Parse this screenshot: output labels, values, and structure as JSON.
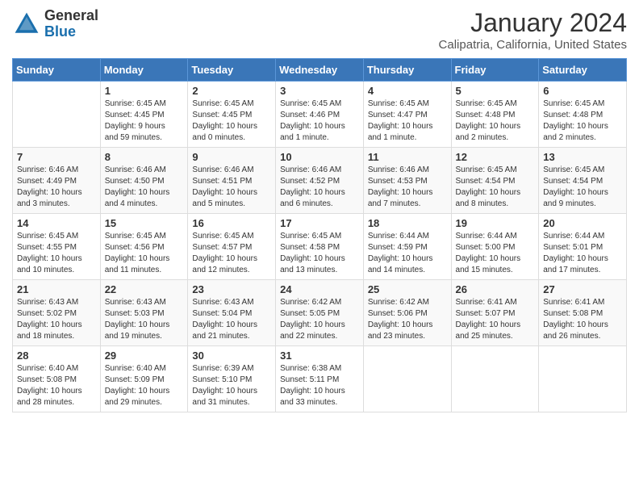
{
  "header": {
    "logo_general": "General",
    "logo_blue": "Blue",
    "month_year": "January 2024",
    "location": "Calipatria, California, United States"
  },
  "weekdays": [
    "Sunday",
    "Monday",
    "Tuesday",
    "Wednesday",
    "Thursday",
    "Friday",
    "Saturday"
  ],
  "weeks": [
    [
      {
        "day": "",
        "info": ""
      },
      {
        "day": "1",
        "info": "Sunrise: 6:45 AM\nSunset: 4:45 PM\nDaylight: 9 hours\nand 59 minutes."
      },
      {
        "day": "2",
        "info": "Sunrise: 6:45 AM\nSunset: 4:45 PM\nDaylight: 10 hours\nand 0 minutes."
      },
      {
        "day": "3",
        "info": "Sunrise: 6:45 AM\nSunset: 4:46 PM\nDaylight: 10 hours\nand 1 minute."
      },
      {
        "day": "4",
        "info": "Sunrise: 6:45 AM\nSunset: 4:47 PM\nDaylight: 10 hours\nand 1 minute."
      },
      {
        "day": "5",
        "info": "Sunrise: 6:45 AM\nSunset: 4:48 PM\nDaylight: 10 hours\nand 2 minutes."
      },
      {
        "day": "6",
        "info": "Sunrise: 6:45 AM\nSunset: 4:48 PM\nDaylight: 10 hours\nand 2 minutes."
      }
    ],
    [
      {
        "day": "7",
        "info": "Sunrise: 6:46 AM\nSunset: 4:49 PM\nDaylight: 10 hours\nand 3 minutes."
      },
      {
        "day": "8",
        "info": "Sunrise: 6:46 AM\nSunset: 4:50 PM\nDaylight: 10 hours\nand 4 minutes."
      },
      {
        "day": "9",
        "info": "Sunrise: 6:46 AM\nSunset: 4:51 PM\nDaylight: 10 hours\nand 5 minutes."
      },
      {
        "day": "10",
        "info": "Sunrise: 6:46 AM\nSunset: 4:52 PM\nDaylight: 10 hours\nand 6 minutes."
      },
      {
        "day": "11",
        "info": "Sunrise: 6:46 AM\nSunset: 4:53 PM\nDaylight: 10 hours\nand 7 minutes."
      },
      {
        "day": "12",
        "info": "Sunrise: 6:45 AM\nSunset: 4:54 PM\nDaylight: 10 hours\nand 8 minutes."
      },
      {
        "day": "13",
        "info": "Sunrise: 6:45 AM\nSunset: 4:54 PM\nDaylight: 10 hours\nand 9 minutes."
      }
    ],
    [
      {
        "day": "14",
        "info": "Sunrise: 6:45 AM\nSunset: 4:55 PM\nDaylight: 10 hours\nand 10 minutes."
      },
      {
        "day": "15",
        "info": "Sunrise: 6:45 AM\nSunset: 4:56 PM\nDaylight: 10 hours\nand 11 minutes."
      },
      {
        "day": "16",
        "info": "Sunrise: 6:45 AM\nSunset: 4:57 PM\nDaylight: 10 hours\nand 12 minutes."
      },
      {
        "day": "17",
        "info": "Sunrise: 6:45 AM\nSunset: 4:58 PM\nDaylight: 10 hours\nand 13 minutes."
      },
      {
        "day": "18",
        "info": "Sunrise: 6:44 AM\nSunset: 4:59 PM\nDaylight: 10 hours\nand 14 minutes."
      },
      {
        "day": "19",
        "info": "Sunrise: 6:44 AM\nSunset: 5:00 PM\nDaylight: 10 hours\nand 15 minutes."
      },
      {
        "day": "20",
        "info": "Sunrise: 6:44 AM\nSunset: 5:01 PM\nDaylight: 10 hours\nand 17 minutes."
      }
    ],
    [
      {
        "day": "21",
        "info": "Sunrise: 6:43 AM\nSunset: 5:02 PM\nDaylight: 10 hours\nand 18 minutes."
      },
      {
        "day": "22",
        "info": "Sunrise: 6:43 AM\nSunset: 5:03 PM\nDaylight: 10 hours\nand 19 minutes."
      },
      {
        "day": "23",
        "info": "Sunrise: 6:43 AM\nSunset: 5:04 PM\nDaylight: 10 hours\nand 21 minutes."
      },
      {
        "day": "24",
        "info": "Sunrise: 6:42 AM\nSunset: 5:05 PM\nDaylight: 10 hours\nand 22 minutes."
      },
      {
        "day": "25",
        "info": "Sunrise: 6:42 AM\nSunset: 5:06 PM\nDaylight: 10 hours\nand 23 minutes."
      },
      {
        "day": "26",
        "info": "Sunrise: 6:41 AM\nSunset: 5:07 PM\nDaylight: 10 hours\nand 25 minutes."
      },
      {
        "day": "27",
        "info": "Sunrise: 6:41 AM\nSunset: 5:08 PM\nDaylight: 10 hours\nand 26 minutes."
      }
    ],
    [
      {
        "day": "28",
        "info": "Sunrise: 6:40 AM\nSunset: 5:08 PM\nDaylight: 10 hours\nand 28 minutes."
      },
      {
        "day": "29",
        "info": "Sunrise: 6:40 AM\nSunset: 5:09 PM\nDaylight: 10 hours\nand 29 minutes."
      },
      {
        "day": "30",
        "info": "Sunrise: 6:39 AM\nSunset: 5:10 PM\nDaylight: 10 hours\nand 31 minutes."
      },
      {
        "day": "31",
        "info": "Sunrise: 6:38 AM\nSunset: 5:11 PM\nDaylight: 10 hours\nand 33 minutes."
      },
      {
        "day": "",
        "info": ""
      },
      {
        "day": "",
        "info": ""
      },
      {
        "day": "",
        "info": ""
      }
    ]
  ]
}
